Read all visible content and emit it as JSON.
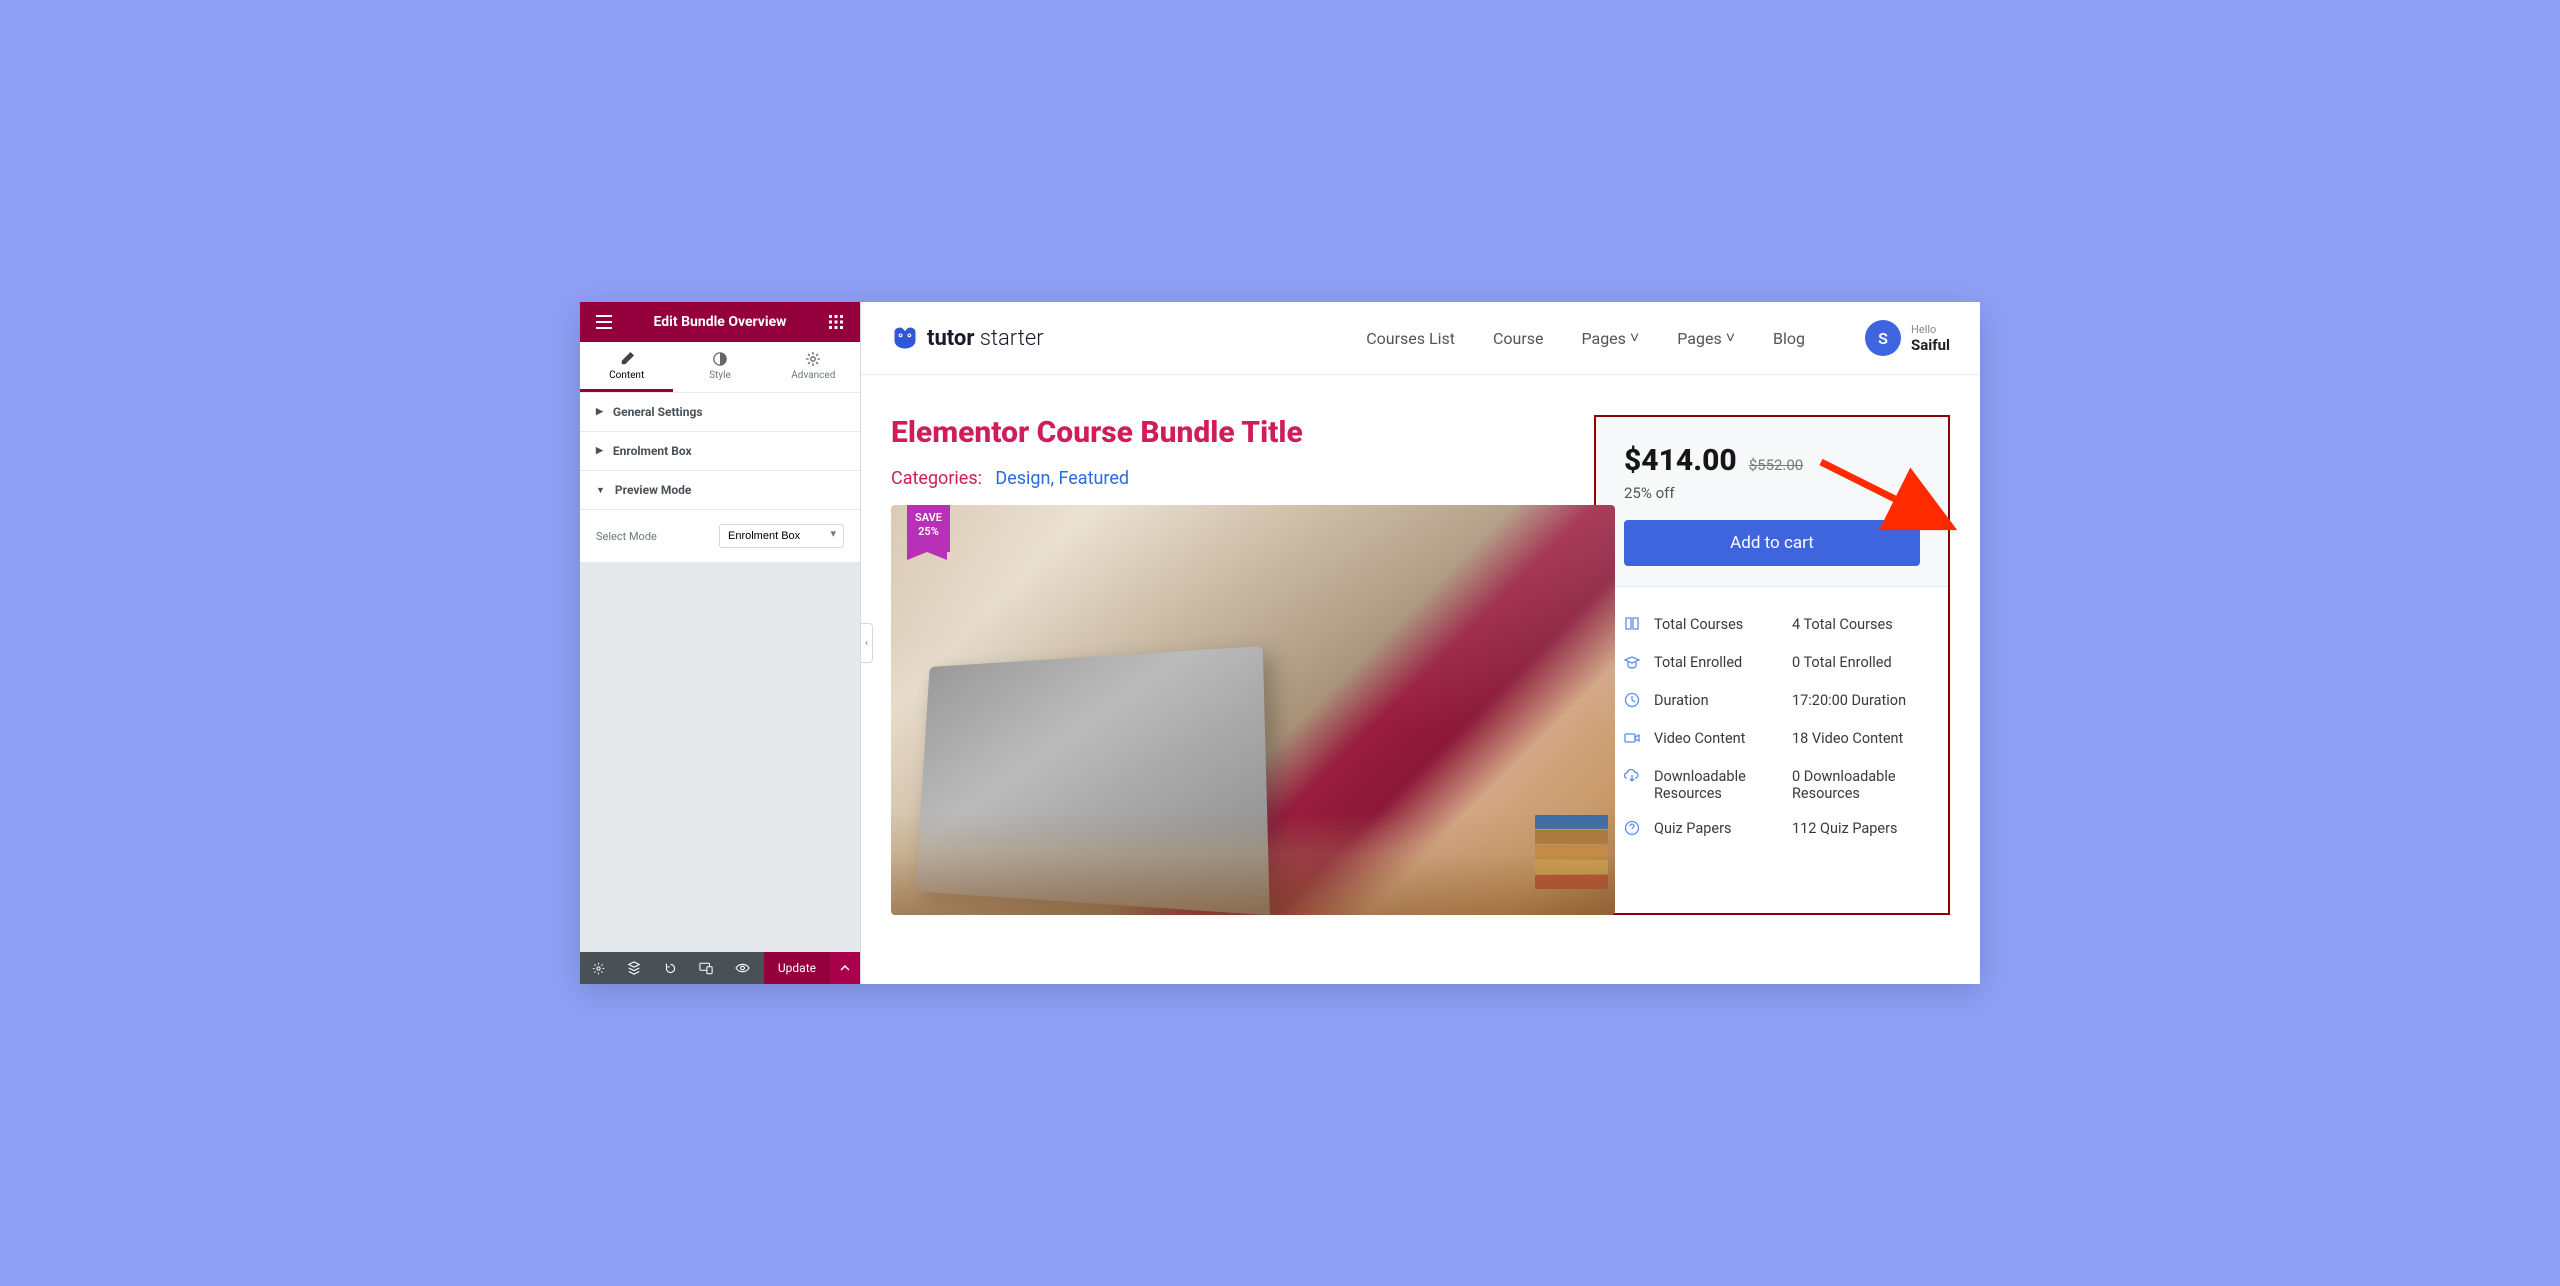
{
  "panel": {
    "title": "Edit Bundle Overview",
    "tabs": {
      "content": "Content",
      "style": "Style",
      "advanced": "Advanced"
    },
    "sections": {
      "general": "General Settings",
      "enrolment": "Enrolment Box",
      "preview_mode": "Preview Mode"
    },
    "select_mode_label": "Select Mode",
    "select_mode_value": "Enrolment Box",
    "update_button": "Update"
  },
  "site": {
    "logo_bold": "tutor",
    "logo_light": " starter",
    "nav": {
      "courses_list": "Courses List",
      "course": "Course",
      "pages1": "Pages",
      "pages2": "Pages",
      "blog": "Blog"
    },
    "user": {
      "initial": "S",
      "hello": "Hello",
      "name": "Saiful"
    }
  },
  "page": {
    "title": "Elementor Course Bundle Title",
    "categories_label": "Categories:",
    "categories": {
      "design": "Design",
      "featured": "Featured"
    },
    "ribbon_line1": "SAVE",
    "ribbon_line2": "25%"
  },
  "enrol": {
    "price": "$414.00",
    "old_price": "$552.00",
    "discount": "25% off",
    "add_to_cart": "Add to cart",
    "meta": [
      {
        "label": "Total Courses",
        "value": "4 Total Courses"
      },
      {
        "label": "Total Enrolled",
        "value": "0 Total Enrolled"
      },
      {
        "label": "Duration",
        "value": "17:20:00 Duration"
      },
      {
        "label": "Video Content",
        "value": "18 Video Content"
      },
      {
        "label": "Downloadable Resources",
        "value": "0 Downloadable Resources"
      },
      {
        "label": "Quiz Papers",
        "value": "112 Quiz Papers"
      }
    ]
  }
}
